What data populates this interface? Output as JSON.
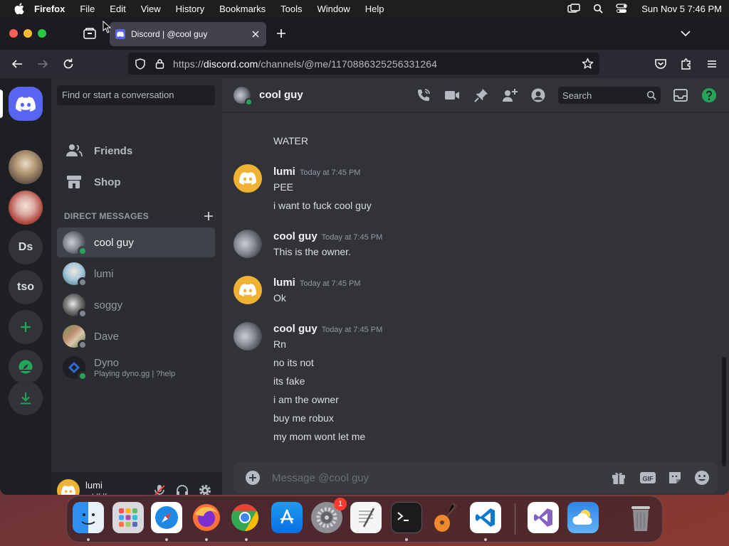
{
  "menubar": {
    "app": "Firefox",
    "items": [
      "File",
      "Edit",
      "View",
      "History",
      "Bookmarks",
      "Tools",
      "Window",
      "Help"
    ],
    "clock": "Sun Nov 5  7:46 PM"
  },
  "browser": {
    "tab_title": "Discord | @cool guy",
    "url_prefix": "https://",
    "url_host": "discord.com",
    "url_path": "/channels/@me/1170886325256331264"
  },
  "guilds": [
    {
      "name": "discord-home",
      "label": ""
    },
    {
      "name": "server-1",
      "label": ""
    },
    {
      "name": "server-2",
      "label": ""
    },
    {
      "name": "server-ds",
      "label": "Ds"
    },
    {
      "name": "server-tso",
      "label": "tso"
    }
  ],
  "sidebar": {
    "search_placeholder": "Find or start a conversation",
    "nav": [
      {
        "label": "Friends"
      },
      {
        "label": "Shop"
      }
    ],
    "dm_header": "DIRECT MESSAGES",
    "dms": [
      {
        "name": "cool guy",
        "status": "online",
        "active": true
      },
      {
        "name": "lumi",
        "status": "offline"
      },
      {
        "name": "soggy",
        "status": "offline"
      },
      {
        "name": "Dave",
        "status": "offline"
      },
      {
        "name": "Dyno",
        "status": "online",
        "activity": "Playing dyno.gg | ?help"
      }
    ],
    "user": {
      "name": "lumi",
      "tag": "sddfdfrwr"
    }
  },
  "chat": {
    "header_name": "cool guy",
    "search_placeholder": "Search",
    "top_fragment": "WATER",
    "messages": [
      {
        "author": "lumi",
        "time": "Today at 7:45 PM",
        "lines": [
          "PEE",
          "i want to fuck cool guy"
        ]
      },
      {
        "author": "cool guy",
        "time": "Today at 7:45 PM",
        "lines": [
          "This is the owner."
        ]
      },
      {
        "author": "lumi",
        "time": "Today at 7:45 PM",
        "lines": [
          "Ok"
        ]
      },
      {
        "author": "cool guy",
        "time": "Today at 7:45 PM",
        "lines": [
          "Rn",
          "no its not",
          "its fake",
          "i am the owner",
          "buy me robux",
          "my mom wont let me"
        ]
      }
    ],
    "composer_placeholder": "Message @cool guy"
  },
  "dock": {
    "apps": [
      "finder",
      "launchpad",
      "safari",
      "firefox",
      "chrome",
      "app-store",
      "system-settings",
      "textedit",
      "terminal",
      "garageband",
      "vscode",
      "visual-studio",
      "weather",
      "trash"
    ],
    "settings_badge": "1"
  },
  "colors": {
    "blurple": "#5865f2",
    "online": "#23a559",
    "accent_yellow": "#f0b232"
  }
}
